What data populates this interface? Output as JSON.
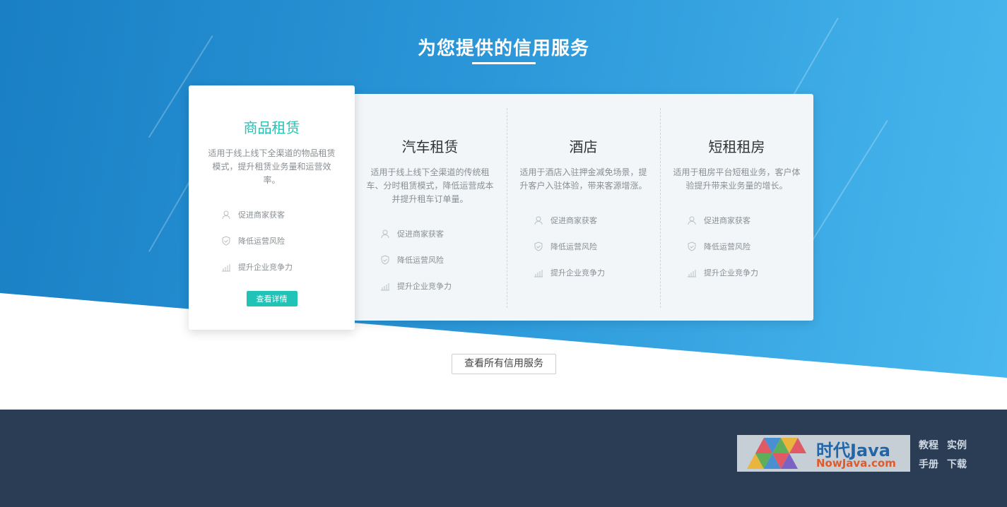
{
  "section": {
    "title": "为您提供的信用服务"
  },
  "featured": {
    "name": "商品租赁",
    "description": "适用于线上线下全渠道的物品租赁模式，提升租赁业务量和运营效率。",
    "features": [
      {
        "icon": "user-icon",
        "label": "促进商家获客"
      },
      {
        "icon": "shield-icon",
        "label": "降低运营风险"
      },
      {
        "icon": "chart-icon",
        "label": "提升企业竞争力"
      }
    ],
    "button_label": "查看详情",
    "accent_color": "#22c3b7"
  },
  "services": [
    {
      "name": "汽车租赁",
      "description": "适用于线上线下全渠道的传统租车、分时租赁模式，降低运营成本并提升租车订单量。",
      "features": [
        {
          "icon": "user-icon",
          "label": "促进商家获客"
        },
        {
          "icon": "shield-icon",
          "label": "降低运营风险"
        },
        {
          "icon": "chart-icon",
          "label": "提升企业竞争力"
        }
      ]
    },
    {
      "name": "酒店",
      "description": "适用于酒店入驻押金减免场景，提升客户入驻体验，带来客源增涨。",
      "features": [
        {
          "icon": "user-icon",
          "label": "促进商家获客"
        },
        {
          "icon": "shield-icon",
          "label": "降低运营风险"
        },
        {
          "icon": "chart-icon",
          "label": "提升企业竞争力"
        }
      ]
    },
    {
      "name": "短租租房",
      "description": "适用于租房平台短租业务，客户体验提升带来业务量的增长。",
      "features": [
        {
          "icon": "user-icon",
          "label": "促进商家获客"
        },
        {
          "icon": "shield-icon",
          "label": "降低运营风险"
        },
        {
          "icon": "chart-icon",
          "label": "提升企业竞争力"
        }
      ]
    }
  ],
  "all_services_button": "查看所有信用服务",
  "watermark": {
    "brand": "时代Java",
    "url": "NowJava.com",
    "links": [
      "教程",
      "实例",
      "手册",
      "下载"
    ]
  },
  "colors": {
    "hero_blue": "#2a96d8",
    "footer": "#2b3d55",
    "accent": "#22c3b7"
  }
}
